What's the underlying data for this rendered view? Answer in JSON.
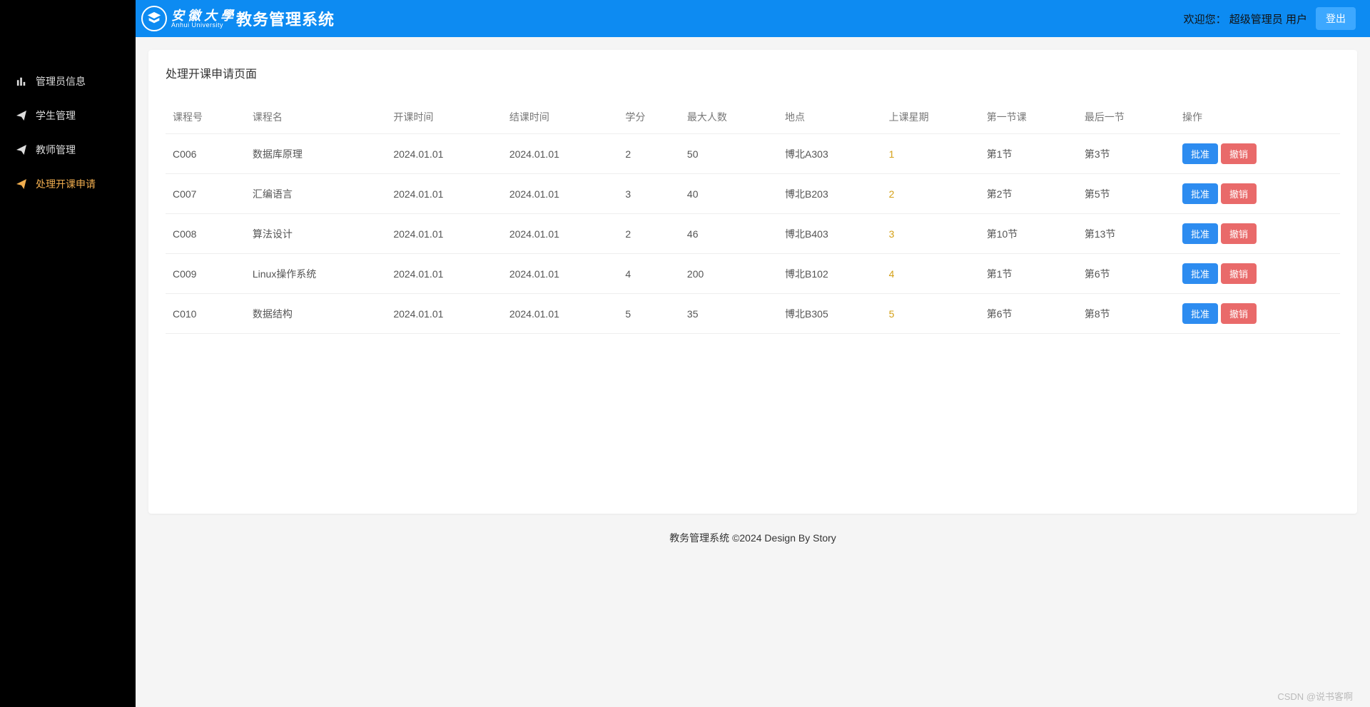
{
  "brand": {
    "university_script": "安 徽 大 學",
    "university_en": "Anhui University",
    "system_title": "教务管理系统"
  },
  "topbar": {
    "welcome_prefix": "欢迎您：",
    "role": "超级管理员",
    "user": "用户",
    "logout": "登出"
  },
  "sidebar": {
    "items": [
      {
        "label": "管理员信息"
      },
      {
        "label": "学生管理"
      },
      {
        "label": "教师管理"
      },
      {
        "label": "处理开课申请"
      }
    ]
  },
  "panel": {
    "title": "处理开课申请页面"
  },
  "table": {
    "headers": {
      "course_no": "课程号",
      "course_name": "课程名",
      "open_time": "开课时间",
      "close_time": "结课时间",
      "credit": "学分",
      "max_people": "最大人数",
      "place": "地点",
      "weekday": "上课星期",
      "first_class": "第一节课",
      "last_class": "最后一节",
      "ops": "操作"
    },
    "ops": {
      "approve": "批准",
      "revoke": "撤销"
    },
    "rows": [
      {
        "no": "C006",
        "name": "数据库原理",
        "open": "2024.01.01",
        "close": "2024.01.01",
        "credit": "2",
        "max": "50",
        "place": "博北A303",
        "week": "1",
        "first": "第1节",
        "last": "第3节"
      },
      {
        "no": "C007",
        "name": "汇编语言",
        "open": "2024.01.01",
        "close": "2024.01.01",
        "credit": "3",
        "max": "40",
        "place": "博北B203",
        "week": "2",
        "first": "第2节",
        "last": "第5节"
      },
      {
        "no": "C008",
        "name": "算法设计",
        "open": "2024.01.01",
        "close": "2024.01.01",
        "credit": "2",
        "max": "46",
        "place": "博北B403",
        "week": "3",
        "first": "第10节",
        "last": "第13节"
      },
      {
        "no": "C009",
        "name": "Linux操作系统",
        "open": "2024.01.01",
        "close": "2024.01.01",
        "credit": "4",
        "max": "200",
        "place": "博北B102",
        "week": "4",
        "first": "第1节",
        "last": "第6节"
      },
      {
        "no": "C010",
        "name": "数据结构",
        "open": "2024.01.01",
        "close": "2024.01.01",
        "credit": "5",
        "max": "35",
        "place": "博北B305",
        "week": "5",
        "first": "第6节",
        "last": "第8节"
      }
    ]
  },
  "footer": {
    "text": "教务管理系统 ©2024 Design By Story"
  },
  "watermark": "CSDN @说书客啊"
}
